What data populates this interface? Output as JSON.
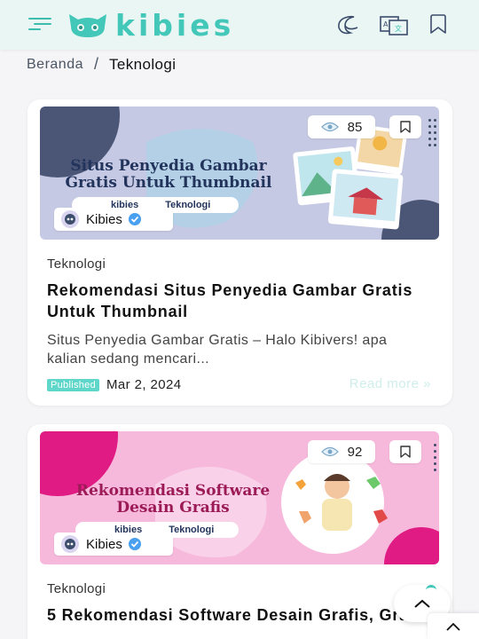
{
  "header": {
    "brand": "kibies",
    "icons": [
      "menu-icon",
      "logo-cat-icon",
      "moon-icon",
      "translate-icon",
      "bookmark-icon"
    ]
  },
  "breadcrumb": {
    "home": "Beranda",
    "separator": "/",
    "current": "Teknologi"
  },
  "posts": [
    {
      "thumbnail": {
        "title_line1": "Situs Penyedia Gambar",
        "title_line2": "Gratis Untuk Thumbnail",
        "pill_brand": "kibies",
        "pill_tag": "Teknologi"
      },
      "views": "85",
      "author": "Kibies",
      "category": "Teknologi",
      "title": "Rekomendasi Situs Penyedia Gambar Gratis Untuk Thumbnail",
      "excerpt": "Situs Penyedia Gambar Gratis – Halo Kibivers! apa kalian sedang mencari...",
      "status": "Published",
      "date": "Mar 2, 2024",
      "read_more": "Read more »"
    },
    {
      "thumbnail": {
        "title_line1": "Rekomendasi Software",
        "title_line2": "Desain Grafis",
        "pill_brand": "kibies",
        "pill_tag": "Teknologi"
      },
      "views": "92",
      "author": "Kibies",
      "category": "Teknologi",
      "title": "5 Rekomendasi Software Desain Grafis, Gratis!"
    }
  ],
  "colors": {
    "accent": "#43c7b8",
    "header_bg": "#eaf6f4",
    "status_bg": "#5ed6c9",
    "thumb1_bg": "#c6c9e3",
    "thumb2_bg": "#f6b9dc"
  }
}
